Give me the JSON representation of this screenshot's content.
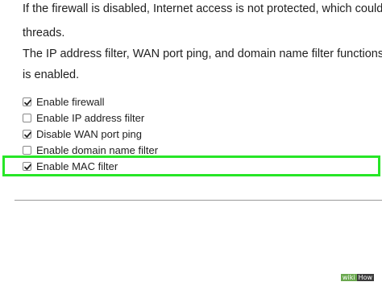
{
  "paragraph": {
    "line1": "If the firewall is disabled, Internet access is not protected, which could",
    "line2": "threads.",
    "line3": "The IP address filter, WAN port ping, and domain name filter functions",
    "line4": "is enabled."
  },
  "options": [
    {
      "label": "Enable firewall",
      "checked": true
    },
    {
      "label": "Enable IP address filter",
      "checked": false
    },
    {
      "label": "Disable WAN port ping",
      "checked": true
    },
    {
      "label": "Enable domain name filter",
      "checked": false
    },
    {
      "label": "Enable MAC filter",
      "checked": true
    }
  ],
  "colors": {
    "highlight": "#27e627",
    "text": "#1f1f1f",
    "rule": "#9a9a9a"
  },
  "watermark": {
    "part1": "wiki",
    "part2": "How"
  }
}
